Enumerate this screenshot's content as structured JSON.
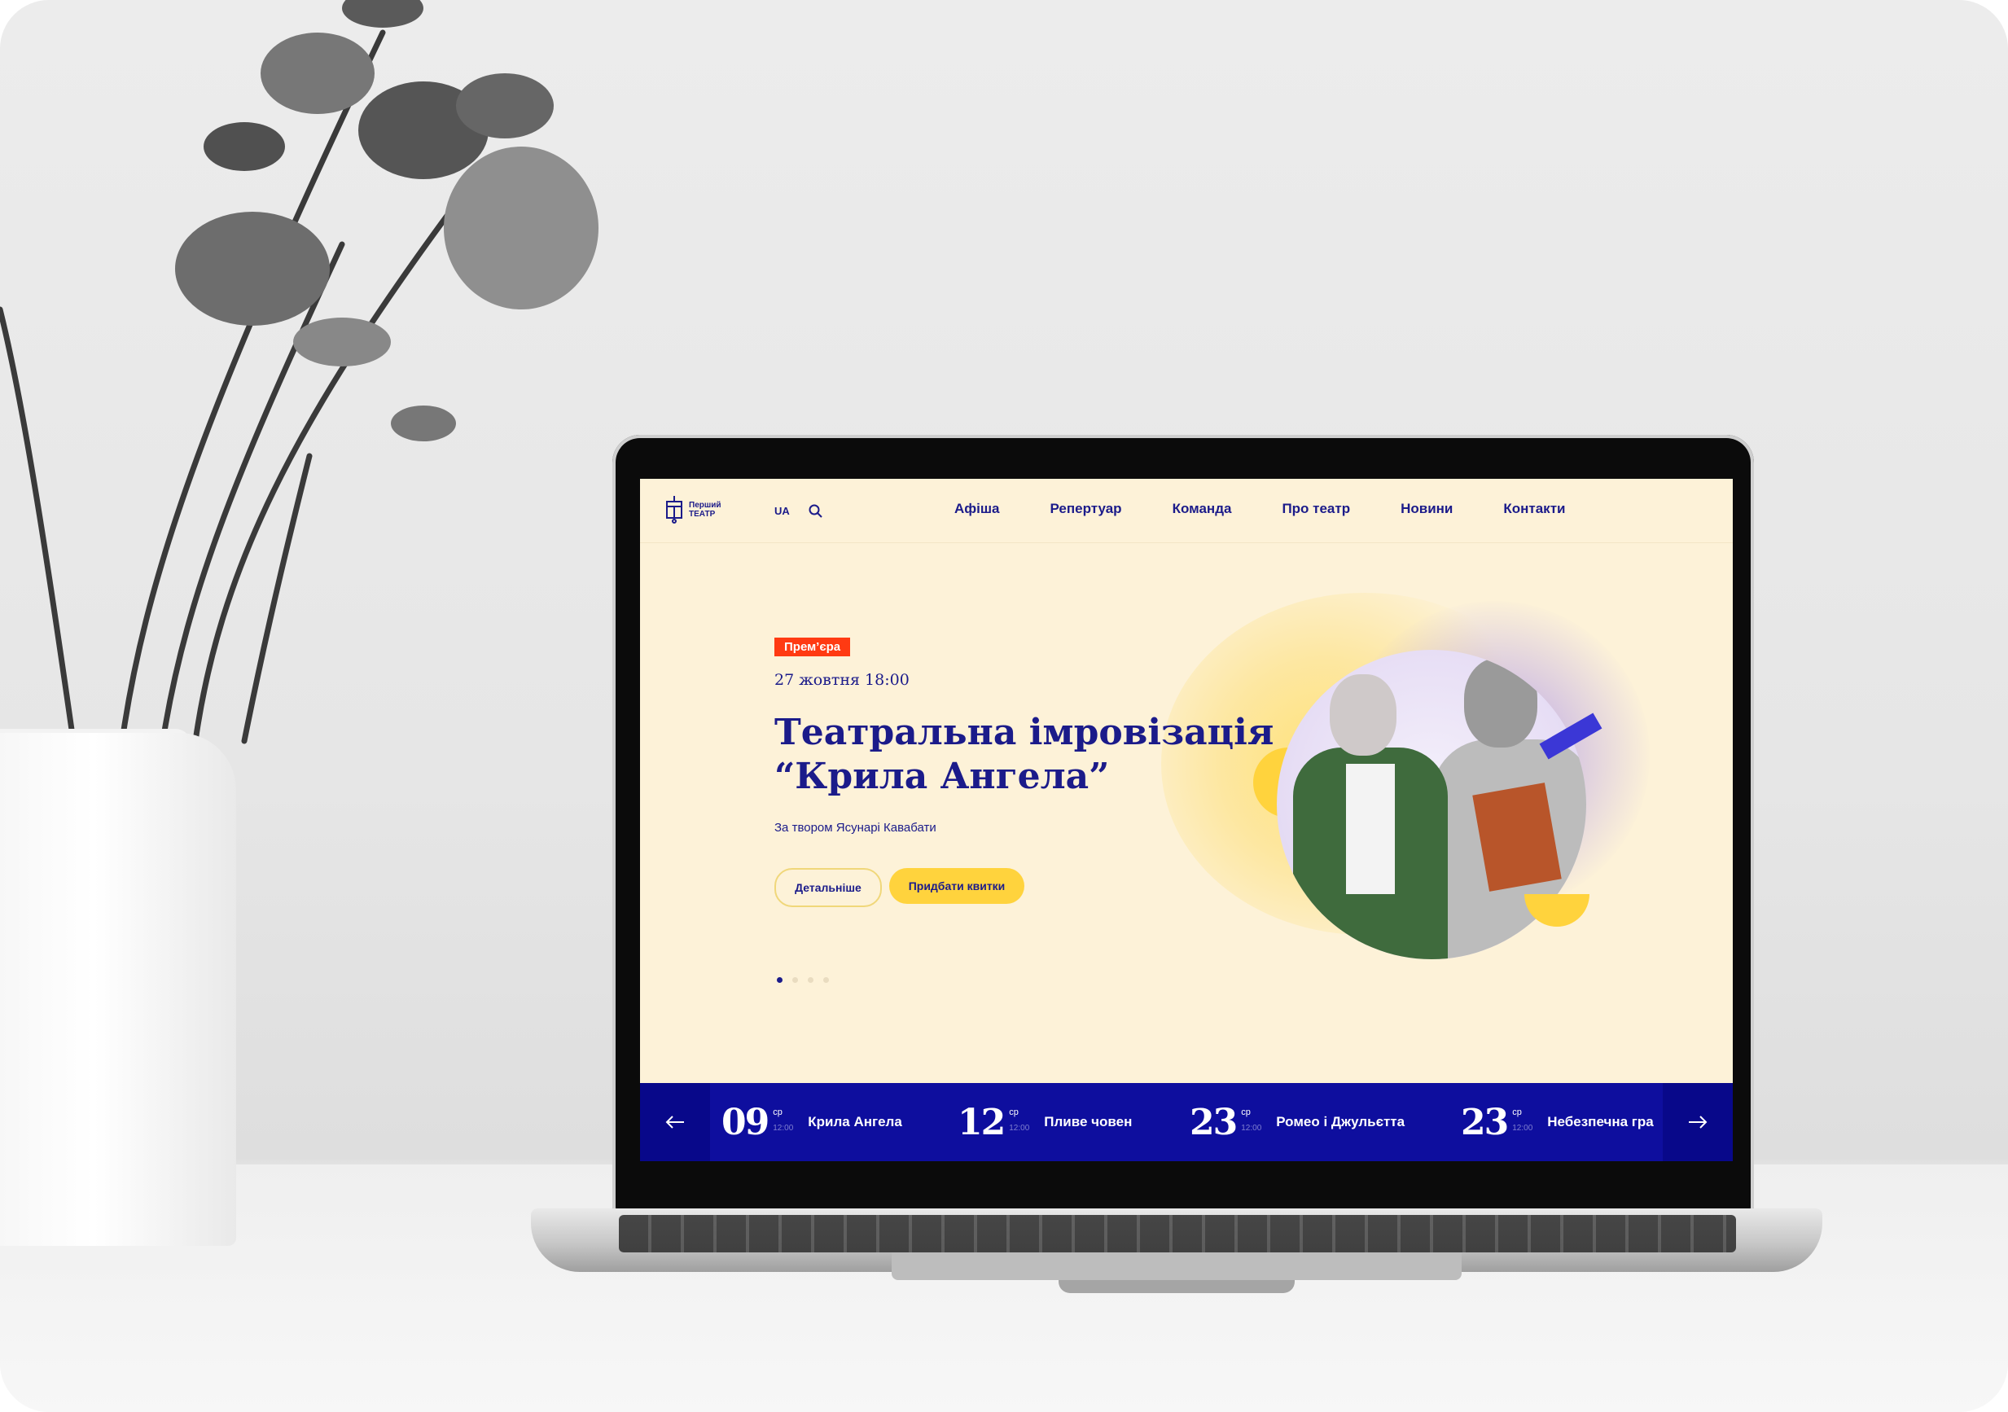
{
  "site": {
    "logo": {
      "line1": "Перший",
      "line2": "ТЕАТР"
    },
    "lang": "UA",
    "nav": [
      "Афіша",
      "Репертуар",
      "Команда",
      "Про театр",
      "Новини",
      "Контакти"
    ]
  },
  "hero": {
    "badge": "Прем’єра",
    "date": "27 жовтня 18:00",
    "title_line1": "Театральна імровізація",
    "title_line2": "“Крила Ангела”",
    "subtitle": "За твором Ясунарі Кавабати",
    "btn_details": "Детальніше",
    "btn_tickets": "Придбати квитки",
    "slides_total": 4,
    "slide_active": 1
  },
  "events": [
    {
      "day": "09",
      "weekday": "ср",
      "time": "12:00",
      "name": "Крила Ангела"
    },
    {
      "day": "12",
      "weekday": "ср",
      "time": "12:00",
      "name": "Пливе човен"
    },
    {
      "day": "23",
      "weekday": "ср",
      "time": "12:00",
      "name": "Ромео і Джульєтта"
    },
    {
      "day": "23",
      "weekday": "ср",
      "time": "12:00",
      "name": "Небезпечна гра"
    }
  ],
  "colors": {
    "brand": "#1b1b8a",
    "accent_yellow": "#ffd33d",
    "badge_red": "#ff3a12",
    "strip_blue": "#0e0e9e",
    "page_bg": "#fdf2d8"
  }
}
